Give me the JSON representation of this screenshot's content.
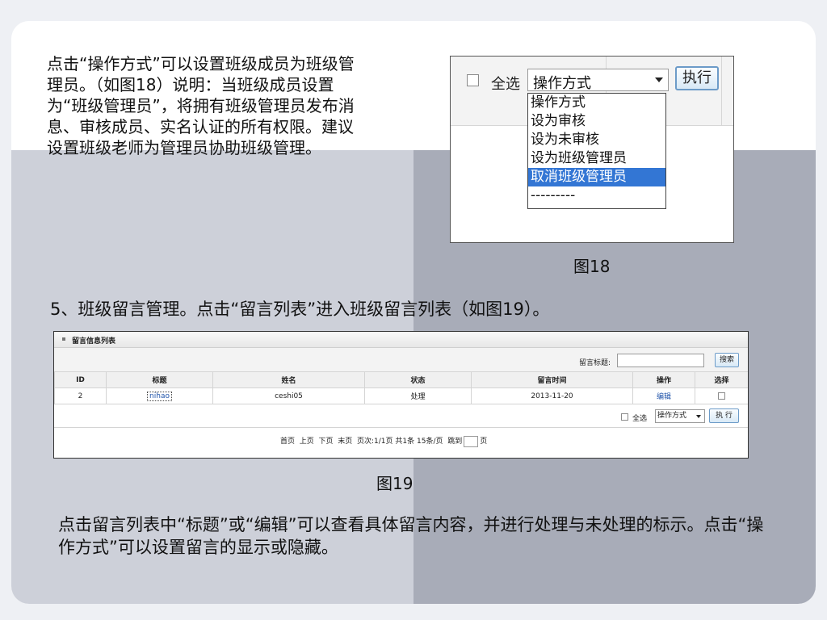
{
  "text": {
    "intro": "点击“操作方式”可以设置班级成员为班级管理员。（如图18）说明：当班级成员设置为“班级管理员”，将拥有班级管理员发布消息、审核成员、实名认证的所有权限。建议设置班级老师为管理员协助班级管理。",
    "caption18": "图18",
    "section5": "5、班级留言管理。点击“留言列表”进入班级留言列表（如图19）。",
    "caption19": "图19",
    "outro": "点击留言列表中“标题”或“编辑”可以查看具体留言内容，并进行处理与未处理的标示。点击“操作方式”可以设置留言的显示或隐藏。"
  },
  "fig18": {
    "select_all": "全选",
    "select_value": "操作方式",
    "execute": "执行",
    "options": [
      "操作方式",
      "设为审核",
      "设为未审核",
      "设为班级管理员",
      "取消班级管理员",
      "---------"
    ],
    "selected_option": "取消班级管理员"
  },
  "fig19": {
    "title": "留言信息列表",
    "search_label": "留言标题:",
    "search_value": "",
    "search_button": "搜索",
    "columns": [
      "ID",
      "标题",
      "姓名",
      "状态",
      "留言时间",
      "操作",
      "选择"
    ],
    "rows": [
      {
        "id": "2",
        "title": "nihao",
        "name": "ceshi05",
        "status": "处理",
        "time": "2013-11-20",
        "op": "编辑"
      }
    ],
    "select_all": "全选",
    "select_value": "操作方式",
    "execute": "执 行",
    "pager": {
      "first": "首页",
      "prev": "上页",
      "next": "下页",
      "last": "末页",
      "pages": "页次:1/1页",
      "total": "共1条",
      "per_page": "15条/页",
      "jump": "跳到",
      "page_suffix": "页"
    }
  }
}
